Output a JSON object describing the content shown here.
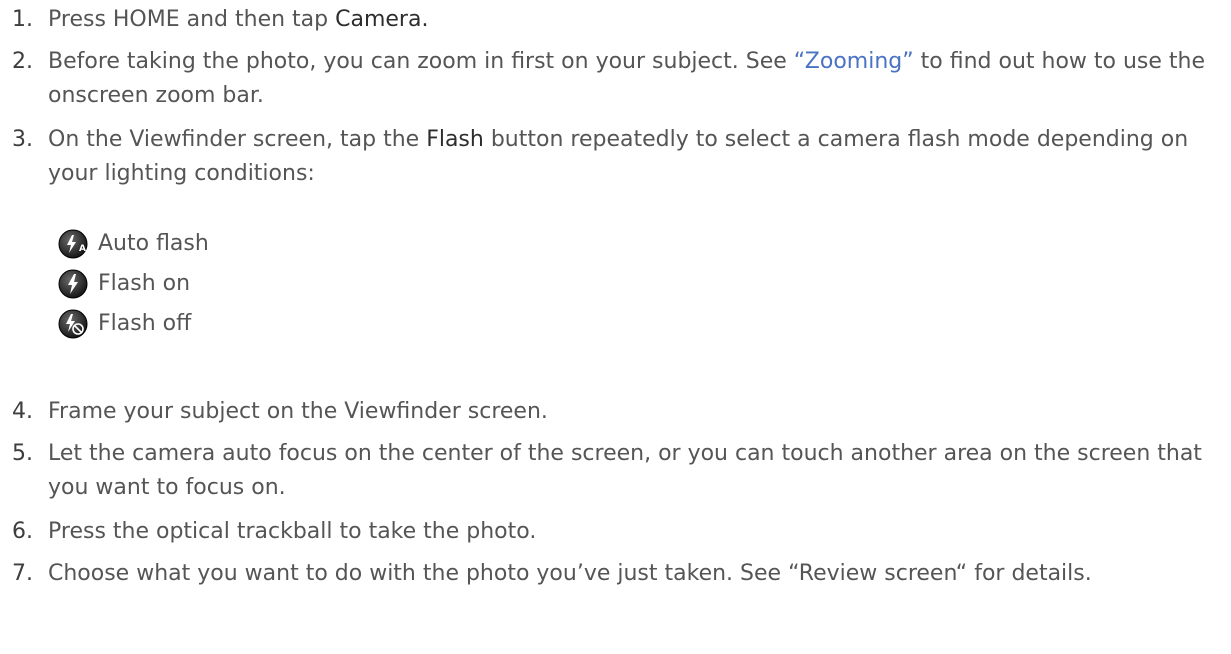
{
  "steps": [
    {
      "number": "1.",
      "text_before": "Press HOME and then tap ",
      "bold": "Camera.",
      "text_after": ""
    },
    {
      "number": "2.",
      "text_before": "Before taking the photo, you can zoom in first on your subject. See ",
      "link": "“Zooming”",
      "text_after": " to find out how to use the onscreen zoom bar."
    },
    {
      "number": "3.",
      "text_before": "On the Viewfinder screen, tap the ",
      "bold": "Flash",
      "text_after": " button repeatedly to select a camera flash mode depending on your lighting conditions:"
    },
    {
      "number": "4.",
      "text": "Frame your subject on the Viewfinder screen."
    },
    {
      "number": "5.",
      "text": "Let the camera auto focus on the center of the screen, or you can touch another area on the screen that you want to focus on."
    },
    {
      "number": "6.",
      "text": "Press the optical trackball to take the photo."
    },
    {
      "number": "7.",
      "text": "Choose what you want to do with the photo you’ve just taken. See “Review screen“ for details."
    }
  ],
  "flash_modes": [
    {
      "icon": "auto-flash-icon",
      "label": "Auto flash"
    },
    {
      "icon": "flash-on-icon",
      "label": "Flash on"
    },
    {
      "icon": "flash-off-icon",
      "label": "Flash off"
    }
  ],
  "colors": {
    "body_text": "#555555",
    "link": "#4a73c4",
    "emphasis": "#2d2d2d"
  }
}
